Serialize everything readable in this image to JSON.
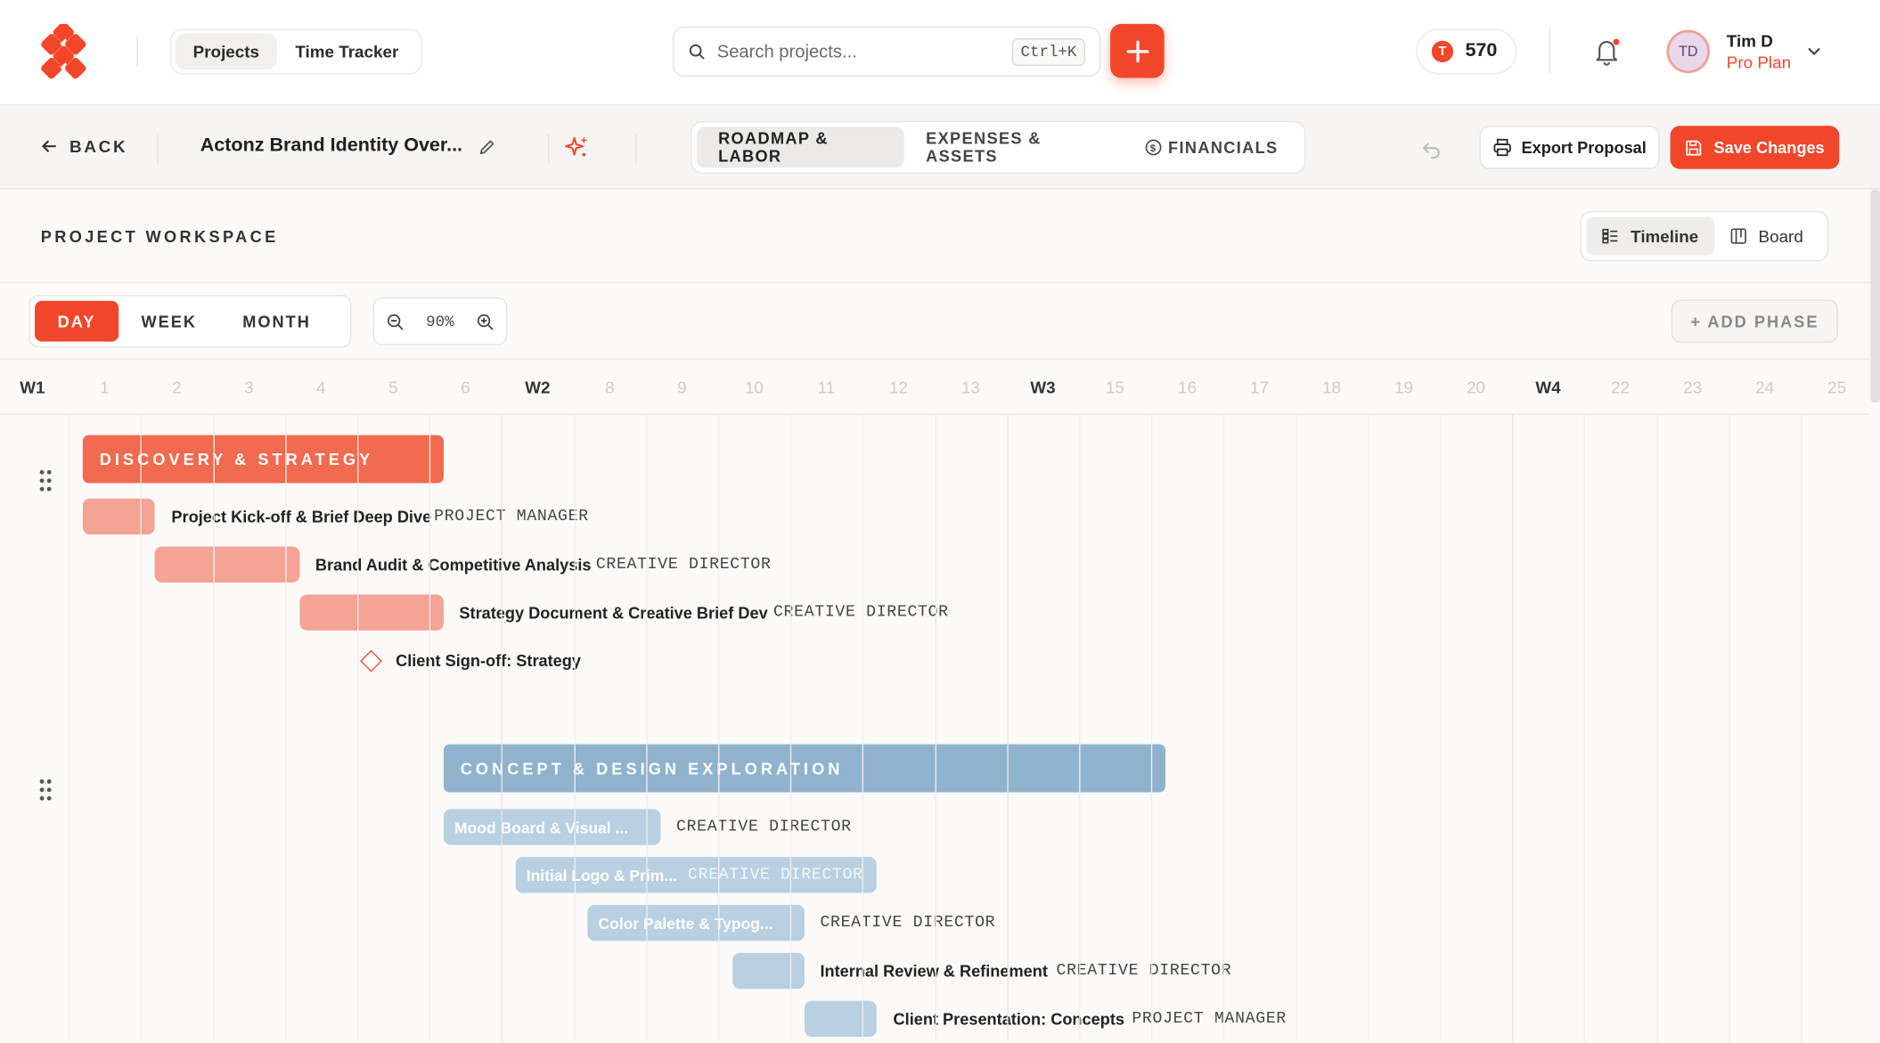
{
  "colors": {
    "accent": "#f2462a",
    "phase1": "#f26a4f",
    "phase1_task": "#f4a394",
    "phase2": "#8fb3cc",
    "phase2_task": "#b8d0e1"
  },
  "header": {
    "nav": [
      {
        "label": "Projects",
        "active": true
      },
      {
        "label": "Time Tracker",
        "active": false
      }
    ],
    "search": {
      "placeholder": "Search projects...",
      "shortcut": "Ctrl+K"
    },
    "tokens": {
      "badge": "T",
      "value": "570"
    },
    "user": {
      "initials": "TD",
      "name": "Tim D",
      "plan": "Pro Plan"
    }
  },
  "subbar": {
    "back_label": "BACK",
    "project_title": "Actonz Brand Identity Over...",
    "tabs": [
      {
        "label": "ROADMAP & LABOR",
        "active": true
      },
      {
        "label": "EXPENSES & ASSETS",
        "active": false
      },
      {
        "label": "FINANCIALS",
        "active": false
      }
    ],
    "export_label": "Export Proposal",
    "save_label": "Save Changes"
  },
  "workspace": {
    "title": "PROJECT WORKSPACE",
    "views": [
      {
        "label": "Timeline",
        "active": true
      },
      {
        "label": "Board",
        "active": false
      }
    ],
    "scales": [
      {
        "label": "DAY",
        "active": true
      },
      {
        "label": "WEEK",
        "active": false
      },
      {
        "label": "MONTH",
        "active": false
      }
    ],
    "zoom": "90%",
    "add_phase_label": "+ ADD PHASE"
  },
  "timeline": {
    "columns": [
      "W1",
      "1",
      "2",
      "3",
      "4",
      "5",
      "6",
      "W2",
      "8",
      "9",
      "10",
      "11",
      "12",
      "13",
      "W3",
      "15",
      "16",
      "17",
      "18",
      "19",
      "20",
      "W4",
      "22",
      "23",
      "24",
      "25"
    ],
    "phases": [
      {
        "name": "DISCOVERY & STRATEGY",
        "tasks": [
          {
            "label": "Project Kick-off & Brief Deep Dive",
            "role": "PROJECT MANAGER"
          },
          {
            "label": "Brand Audit & Competitive Analysis",
            "role": "CREATIVE DIRECTOR"
          },
          {
            "label": "Strategy Document & Creative Brief Dev",
            "role": "CREATIVE DIRECTOR"
          },
          {
            "label": "Client Sign-off: Strategy",
            "role": ""
          }
        ]
      },
      {
        "name": "CONCEPT & DESIGN EXPLORATION",
        "tasks": [
          {
            "label": "Mood Board & Visual ...",
            "role": "CREATIVE DIRECTOR"
          },
          {
            "label": "Initial Logo & Prim...",
            "role": "CREATIVE DIRECTOR"
          },
          {
            "label": "Color Palette & Typog...",
            "role": "CREATIVE DIRECTOR"
          },
          {
            "label": "Internal Review & Refinement",
            "role": "CREATIVE DIRECTOR"
          },
          {
            "label": "Client Presentation: Concepts",
            "role": "PROJECT MANAGER"
          }
        ]
      }
    ]
  }
}
